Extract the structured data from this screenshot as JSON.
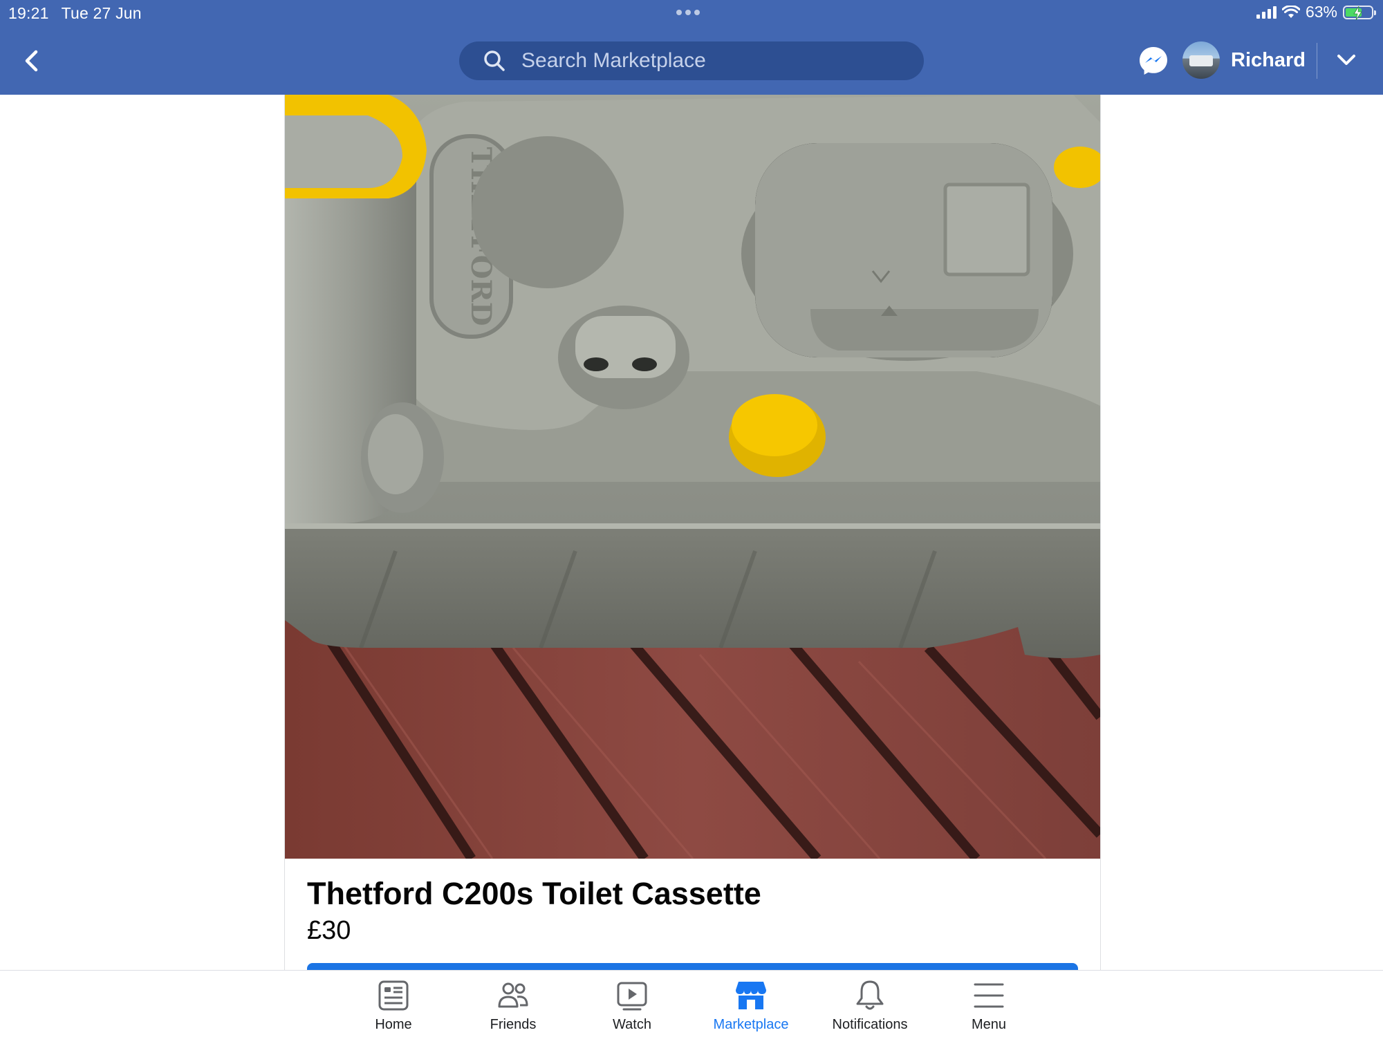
{
  "status_bar": {
    "time": "19:21",
    "date": "Tue 27 Jun",
    "battery_percent": "63%",
    "battery_level": 0.63
  },
  "header": {
    "search": {
      "placeholder": "Search Marketplace",
      "value": ""
    },
    "profile": {
      "name": "Richard"
    },
    "icons": {
      "back": "chevron-left-icon",
      "search": "search-icon",
      "messenger": "messenger-icon",
      "dropdown": "chevron-down-icon"
    },
    "colors": {
      "header_bg": "#4267b2",
      "search_bg": "#2d4f92"
    }
  },
  "listing": {
    "title": "Thetford C200s Toilet Cassette",
    "price": "£30",
    "photo_brand_text": "THETFORD",
    "button_color": "#1b74e4"
  },
  "bottom_nav": {
    "items": [
      {
        "label": "Home",
        "icon": "home-feed-icon",
        "active": false
      },
      {
        "label": "Friends",
        "icon": "friends-icon",
        "active": false
      },
      {
        "label": "Watch",
        "icon": "watch-play-icon",
        "active": false
      },
      {
        "label": "Marketplace",
        "icon": "marketplace-store-icon",
        "active": true
      },
      {
        "label": "Notifications",
        "icon": "bell-icon",
        "active": false
      },
      {
        "label": "Menu",
        "icon": "hamburger-menu-icon",
        "active": false
      }
    ],
    "active_color": "#1877f2"
  }
}
